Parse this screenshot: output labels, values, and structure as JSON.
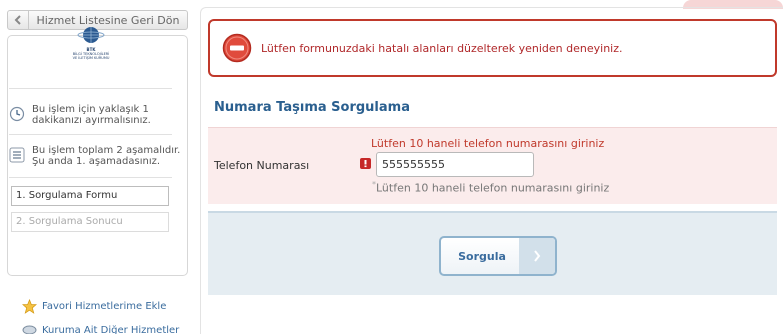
{
  "sidebar": {
    "back_label": "Hizmet Listesine Geri Dön",
    "logo_line1": "BTK",
    "logo_line2": "BİLGİ TEKNOLOJİLERİ",
    "logo_line3": "VE İLETİŞİM KURUMU",
    "duration_text": "Bu işlem için yaklaşık 1 dakikanızı ayırmalısınız.",
    "steps_text": "Bu işlem toplam 2 aşamalıdır. Şu anda 1. aşamadasınız.",
    "steps": [
      "1. Sorgulama Formu",
      "2. Sorgulama Sonucu"
    ],
    "favorite_label": "Favori Hizmetlerime Ekle",
    "other_label": "Kuruma Ait Diğer Hizmetler"
  },
  "error": {
    "message": "Lütfen formunuzdaki hatalı alanları düzelterek yeniden deneyiniz."
  },
  "form": {
    "title": "Numara Taşıma Sorgulama",
    "field_label": "Telefon Numarası",
    "field_error": "Lütfen 10 haneli telefon numarasını giriniz",
    "field_value": "555555555",
    "hint_mark": "*",
    "hint": "Lütfen 10 haneli telefon numarasını giriniz",
    "submit_label": "Sorgula"
  },
  "colors": {
    "error_red": "#c0392b",
    "link_blue": "#3a6c9e",
    "title_blue": "#2a5f8f",
    "form_pink": "#fbecec",
    "submit_bg": "#e5edf2"
  },
  "icons": {
    "back": "chevron-left-icon",
    "clock": "clock-icon",
    "steps": "list-icon",
    "favorite": "star-icon",
    "other": "link-icon",
    "error": "minus-circle-icon",
    "warning": "exclamation-icon",
    "submit_arrow": "chevron-right-icon"
  }
}
